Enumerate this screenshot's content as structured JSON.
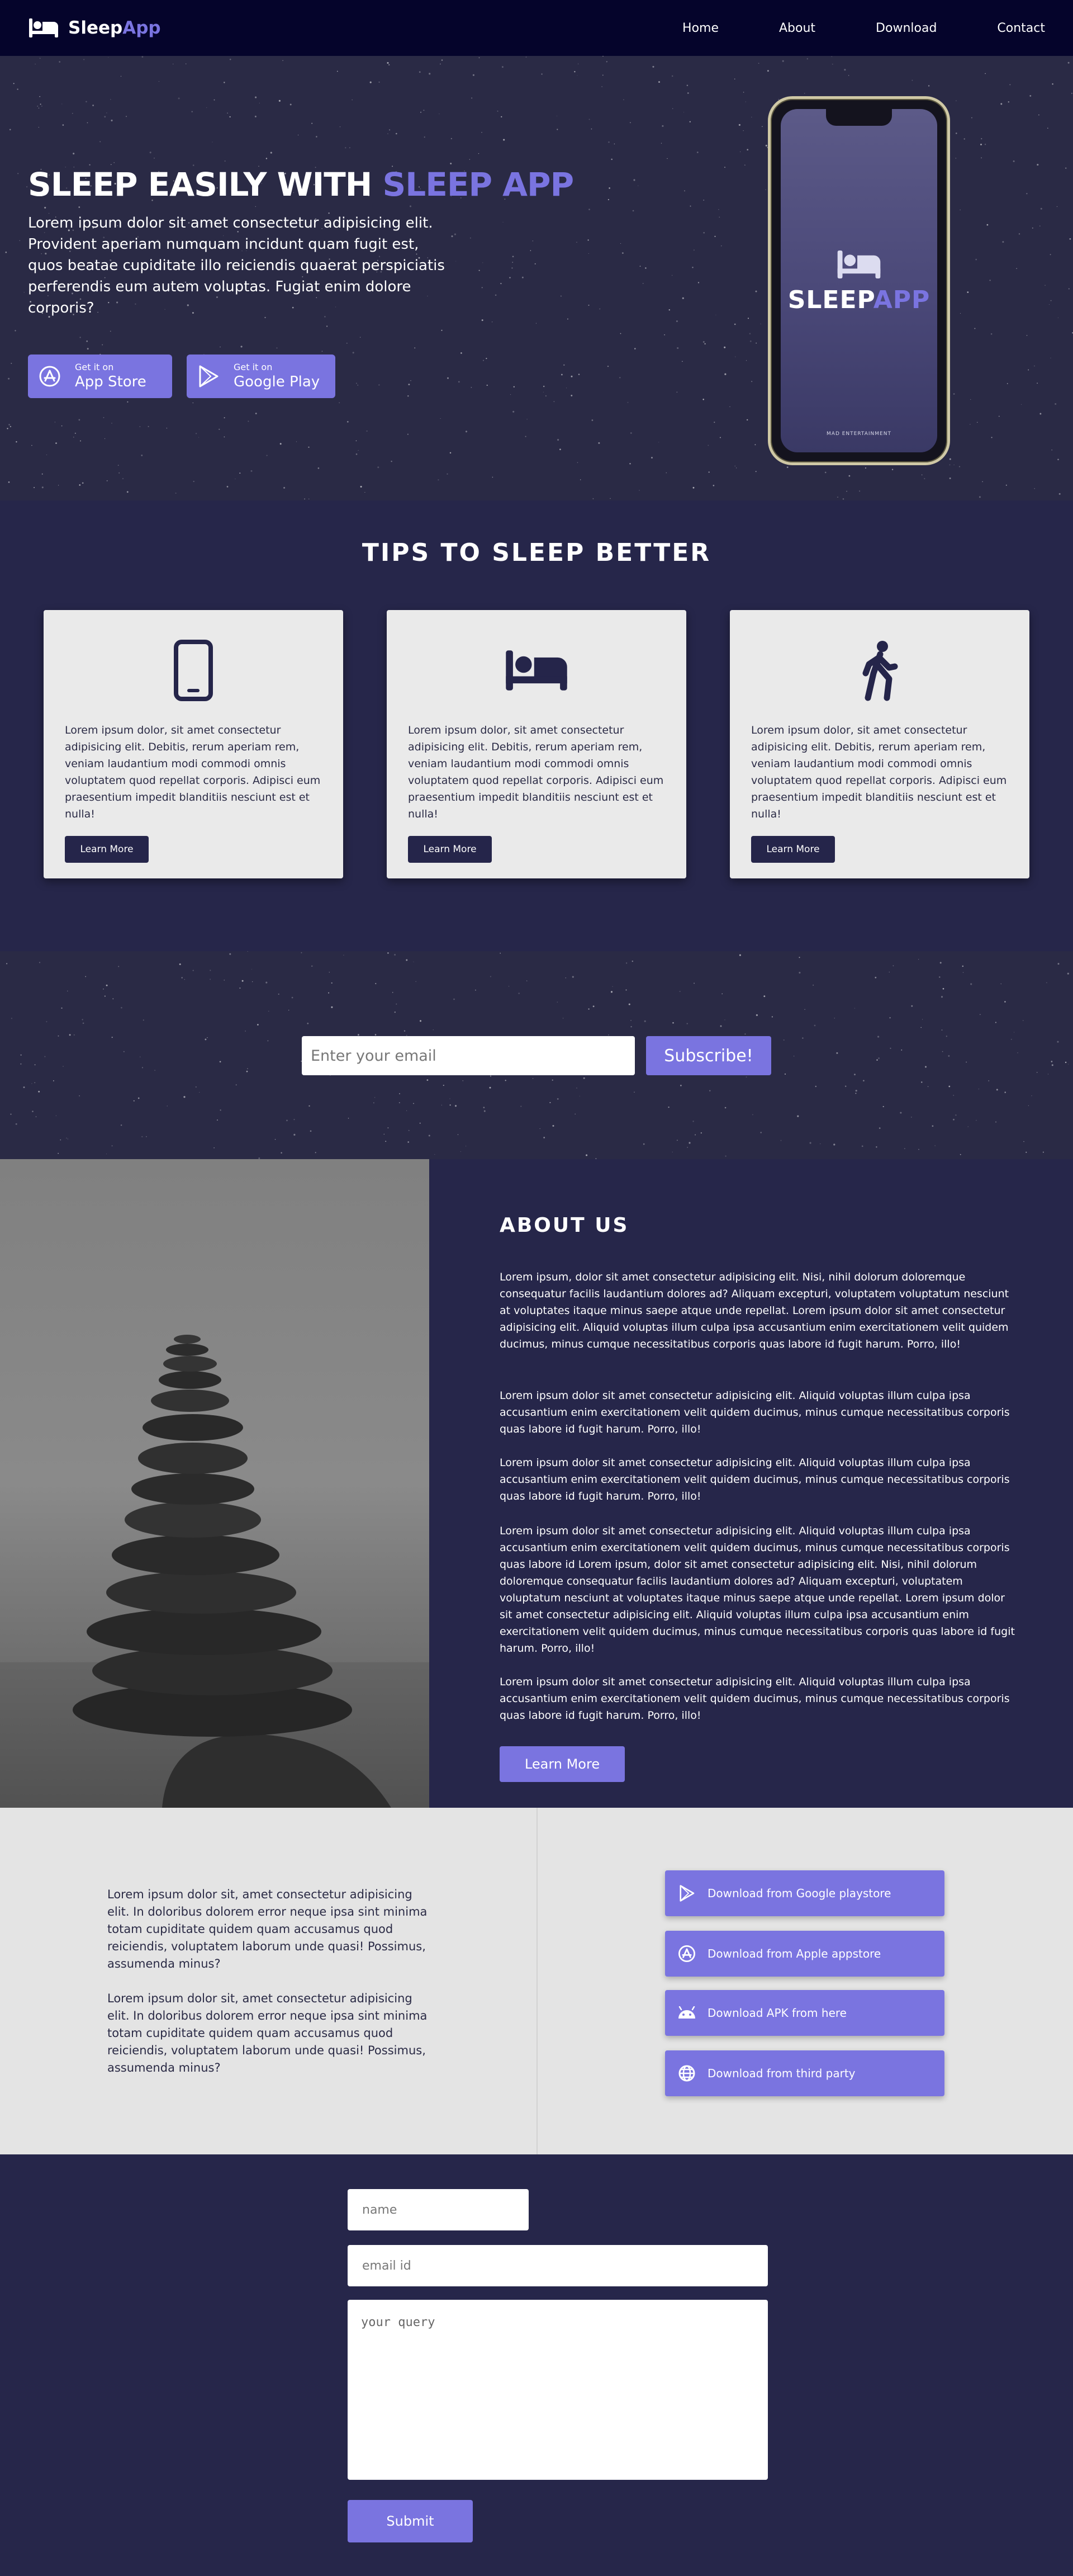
{
  "colors": {
    "nav_bg": "#05042b",
    "accent": "#7a74e0",
    "section_bg": "#26264a",
    "hero_bg": "#2a2a45",
    "card_bg": "#eaeaea",
    "download_bg": "#e4e4e4"
  },
  "nav": {
    "brand_main": "Sleep",
    "brand_accent": "App",
    "links": [
      "Home",
      "About",
      "Download",
      "Contact"
    ]
  },
  "hero": {
    "title_main": "SLEEP EASILY WITH ",
    "title_accent": "SLEEP APP",
    "text": "Lorem ipsum dolor sit amet consectetur adipisicing elit. Provident aperiam numquam incidunt quam fugit est, quos beatae cupiditate illo reiciendis quaerat perspiciatis perferendis eum autem voluptas. Fugiat enim dolore corporis?",
    "appstore": {
      "small": "Get it on",
      "big": "App Store",
      "icon": "appstore-icon"
    },
    "playstore": {
      "small": "Get it on",
      "big": "Google Play",
      "icon": "playstore-icon"
    },
    "phone": {
      "word_main": "SLEEP",
      "word_accent": "APP",
      "credit": "MAD ENTERTAINMENT",
      "icon": "bed-icon"
    }
  },
  "tips": {
    "title": "TIPS TO SLEEP BETTER",
    "cards": [
      {
        "icon": "phone-icon",
        "text": "Lorem ipsum dolor, sit amet consectetur adipisicing elit. Debitis, rerum aperiam rem, veniam laudantium modi commodi omnis voluptatem quod repellat corporis. Adipisci eum praesentium impedit blanditiis nesciunt est et nulla!",
        "button": "Learn More"
      },
      {
        "icon": "bed-icon",
        "text": "Lorem ipsum dolor, sit amet consectetur adipisicing elit. Debitis, rerum aperiam rem, veniam laudantium modi commodi omnis voluptatem quod repellat corporis. Adipisci eum praesentium impedit blanditiis nesciunt est et nulla!",
        "button": "Learn More"
      },
      {
        "icon": "walking-icon",
        "text": "Lorem ipsum dolor, sit amet consectetur adipisicing elit. Debitis, rerum aperiam rem, veniam laudantium modi commodi omnis voluptatem quod repellat corporis. Adipisci eum praesentium impedit blanditiis nesciunt est et nulla!",
        "button": "Learn More"
      }
    ]
  },
  "subscribe": {
    "placeholder": "Enter your email",
    "button": "Subscribe!"
  },
  "about": {
    "title": "ABOUT US",
    "paragraphs": [
      "Lorem ipsum, dolor sit amet consectetur adipisicing elit. Nisi, nihil dolorum doloremque consequatur facilis laudantium dolores ad? Aliquam excepturi, voluptatem voluptatum nesciunt at voluptates itaque minus saepe atque unde repellat. Lorem ipsum dolor sit amet consectetur adipisicing elit. Aliquid voluptas illum culpa ipsa accusantium enim exercitationem velit quidem ducimus, minus cumque necessitatibus corporis quas labore id fugit harum. Porro, illo!",
      "Lorem ipsum dolor sit amet consectetur adipisicing elit. Aliquid voluptas illum culpa ipsa accusantium enim exercitationem velit quidem ducimus, minus cumque necessitatibus corporis quas labore id fugit harum. Porro, illo!",
      "Lorem ipsum dolor sit amet consectetur adipisicing elit. Aliquid voluptas illum culpa ipsa accusantium enim exercitationem velit quidem ducimus, minus cumque necessitatibus corporis quas labore id fugit harum. Porro, illo!",
      "Lorem ipsum dolor sit amet consectetur adipisicing elit. Aliquid voluptas illum culpa ipsa accusantium enim exercitationem velit quidem ducimus, minus cumque necessitatibus corporis quas labore id Lorem ipsum, dolor sit amet consectetur adipisicing elit. Nisi, nihil dolorum doloremque consequatur facilis laudantium dolores ad? Aliquam excepturi, voluptatem voluptatum nesciunt at voluptates itaque minus saepe atque unde repellat. Lorem ipsum dolor sit amet consectetur adipisicing elit. Aliquid voluptas illum culpa ipsa accusantium enim exercitationem velit quidem ducimus, minus cumque necessitatibus corporis quas labore id fugit harum. Porro, illo!",
      "Lorem ipsum dolor sit amet consectetur adipisicing elit. Aliquid voluptas illum culpa ipsa accusantium enim exercitationem velit quidem ducimus, minus cumque necessitatibus corporis quas labore id fugit harum. Porro, illo!"
    ],
    "button": "Learn More"
  },
  "download": {
    "paragraphs": [
      "Lorem ipsum dolor sit, amet consectetur adipisicing elit. In doloribus dolorem error neque ipsa sint minima totam cupiditate quidem quam accusamus quod reiciendis, voluptatem laborum unde quasi! Possimus, assumenda minus?",
      "Lorem ipsum dolor sit, amet consectetur adipisicing elit. In doloribus dolorem error neque ipsa sint minima totam cupiditate quidem quam accusamus quod reiciendis, voluptatem laborum unde quasi! Possimus, assumenda minus?"
    ],
    "buttons": [
      {
        "label": "Download from Google playstore",
        "icon": "playstore-icon"
      },
      {
        "label": "Download from Apple appstore",
        "icon": "appstore-icon"
      },
      {
        "label": "Download APK from here",
        "icon": "android-icon"
      },
      {
        "label": "Download from third party",
        "icon": "globe-icon"
      }
    ]
  },
  "contact": {
    "name_placeholder": "name",
    "email_placeholder": "email id",
    "query_placeholder": "your query",
    "submit": "Submit"
  }
}
